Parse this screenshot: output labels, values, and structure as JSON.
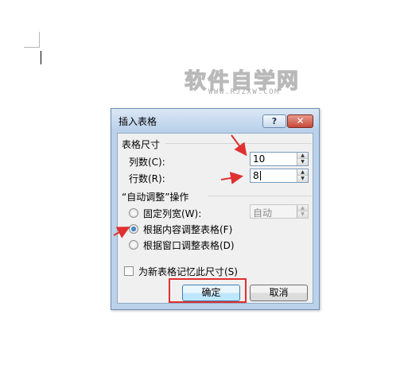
{
  "watermark": {
    "main": "软件自学网",
    "sub": "WWW.RJZXW.COM"
  },
  "dialog": {
    "title": "插入表格",
    "help_symbol": "?",
    "close_symbol": "✕",
    "size_section": {
      "label": "表格尺寸",
      "columns_label": "列数(C):",
      "columns_value": "10",
      "rows_label": "行数(R):",
      "rows_value": "8"
    },
    "autofit_section": {
      "label": "“自动调整”操作",
      "options": [
        {
          "label": "固定列宽(W):",
          "selected": false
        },
        {
          "label": "根据内容调整表格(F)",
          "selected": true
        },
        {
          "label": "根据窗口调整表格(D)",
          "selected": false
        }
      ],
      "fixed_width_value": "自动"
    },
    "remember_checkbox": {
      "label": "为新表格记忆此尺寸(S)",
      "checked": false
    },
    "ok_label": "确定",
    "cancel_label": "取消"
  },
  "colors": {
    "annotation_red": "#e03030",
    "titlebar": "#c7daf0",
    "accent_blue": "#1b5aa6"
  },
  "icons": [
    "help-icon",
    "close-icon",
    "spin-up-icon",
    "spin-down-icon",
    "radio-icon",
    "checkbox-icon",
    "arrow-annotation"
  ]
}
